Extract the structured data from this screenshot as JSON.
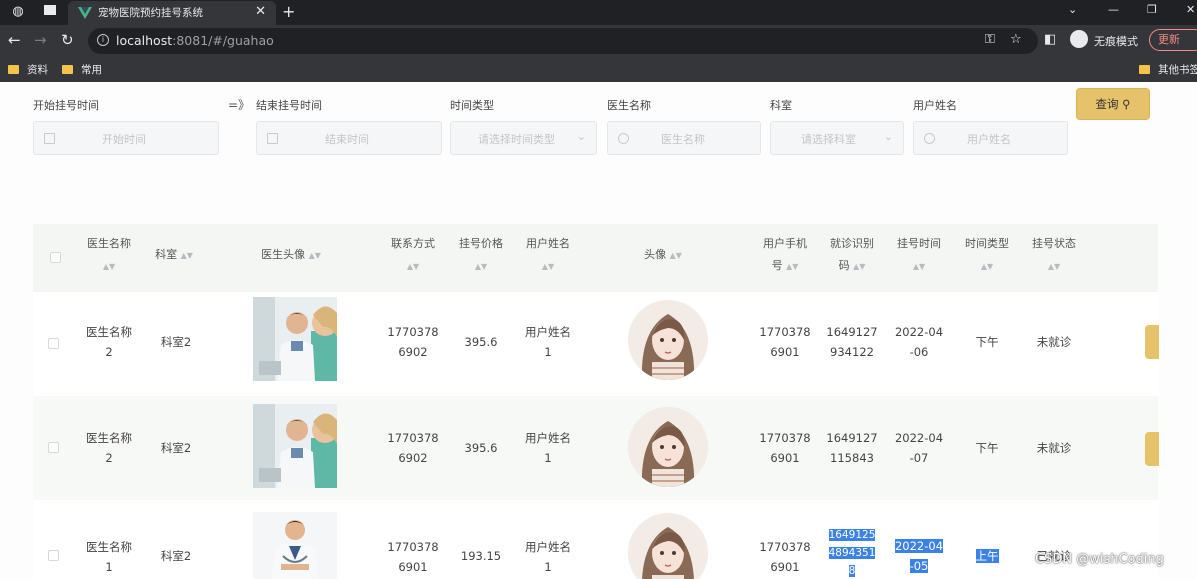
{
  "browser": {
    "tab_title": "宠物医院预约挂号系统",
    "url_host": "localhost",
    "url_rest": ":8081/#/guahao",
    "incognito_label": "无痕模式",
    "update_label": "更新",
    "bookmarks": [
      "资料",
      "常用"
    ],
    "other_bookmarks": "其他书签"
  },
  "filters": {
    "start_label": "开始挂号时间",
    "start_placeholder": "开始时间",
    "arrow": "=》",
    "end_label": "结束挂号时间",
    "end_placeholder": "结束时间",
    "type_label": "时间类型",
    "type_placeholder": "请选择时间类型",
    "doctor_label": "医生名称",
    "doctor_placeholder": "医生名称",
    "dept_label": "科室",
    "dept_placeholder": "请选择科室",
    "user_label": "用户姓名",
    "user_placeholder": "用户姓名",
    "query_label": "查询"
  },
  "table": {
    "headers": {
      "doctor": [
        "医生名称",
        ""
      ],
      "dept": "科室",
      "doctor_photo": "医生头像",
      "contact": [
        "联系方式",
        ""
      ],
      "price": [
        "挂号价格",
        ""
      ],
      "user_name": [
        "用户姓名",
        ""
      ],
      "avatar": "头像",
      "user_phone": [
        "用户手机",
        "号"
      ],
      "visit_code": [
        "就诊识别",
        "码"
      ],
      "reg_time": [
        "挂号时间",
        ""
      ],
      "time_type": [
        "时间类型",
        ""
      ],
      "status": [
        "挂号状态",
        ""
      ]
    },
    "rows": [
      {
        "doctor": [
          "医生名称",
          "2"
        ],
        "dept": "科室2",
        "contact": [
          "1770378",
          "6902"
        ],
        "price": "395.6",
        "user_name": [
          "用户姓名",
          "1"
        ],
        "user_phone": [
          "1770378",
          "6901"
        ],
        "visit_code": [
          "1649127",
          "934122"
        ],
        "reg_time": [
          "2022-04",
          "-06"
        ],
        "time_type": "下午",
        "status": "未就诊"
      },
      {
        "doctor": [
          "医生名称",
          "2"
        ],
        "dept": "科室2",
        "contact": [
          "1770378",
          "6902"
        ],
        "price": "395.6",
        "user_name": [
          "用户姓名",
          "1"
        ],
        "user_phone": [
          "1770378",
          "6901"
        ],
        "visit_code": [
          "1649127",
          "115843"
        ],
        "reg_time": [
          "2022-04",
          "-07"
        ],
        "time_type": "下午",
        "status": "未就诊"
      },
      {
        "doctor": [
          "医生名称",
          "1"
        ],
        "dept": "科室2",
        "contact": [
          "1770378",
          "6901"
        ],
        "price": "193.15",
        "user_name": [
          "用户姓名",
          "1"
        ],
        "user_phone": [
          "1770378",
          "6901"
        ],
        "visit_code": [
          "1649125",
          "4894351",
          "8"
        ],
        "reg_time": [
          "2022-04",
          "-05"
        ],
        "time_type": "上午",
        "status": "已就诊"
      }
    ]
  },
  "watermark": "CSDN @wishCoding",
  "colors": {
    "accent": "#e6c36b",
    "selection": "#3b82e8"
  }
}
